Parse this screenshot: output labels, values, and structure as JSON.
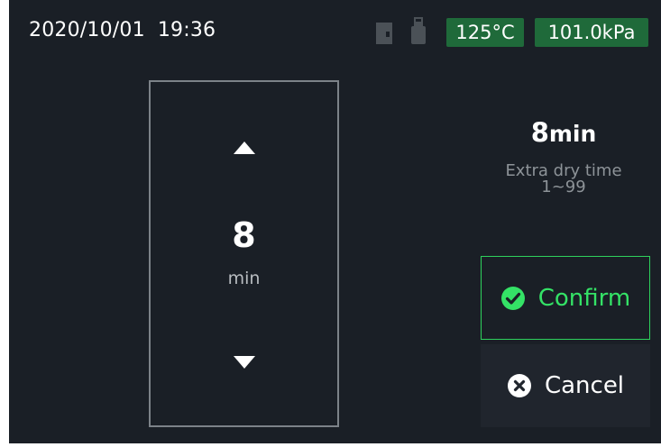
{
  "status_bar": {
    "date": "2020/10/01",
    "time": "19:36",
    "temperature": "125°C",
    "pressure": "101.0kPa",
    "icons": [
      "sd-card-icon",
      "usb-drive-icon"
    ]
  },
  "picker": {
    "value": "8",
    "unit": "min"
  },
  "summary": {
    "value": "8",
    "unit": "min",
    "label": "Extra dry time",
    "range": "1~99"
  },
  "actions": {
    "confirm_label": "Confirm",
    "cancel_label": "Cancel"
  },
  "colors": {
    "background": "#1a1f26",
    "badge": "#1f6a3a",
    "confirm_accent": "#34e266",
    "cancel_background": "#20252d",
    "picker_border": "#7c8288"
  }
}
